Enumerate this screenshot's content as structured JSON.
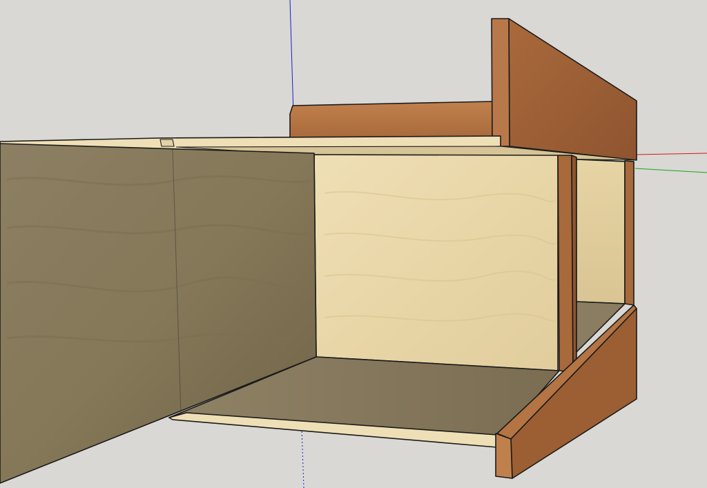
{
  "app": {
    "view": "3d-model-viewport"
  },
  "scene": {
    "background_color": "#d9d8d4",
    "axes": {
      "red_axis_color": "#d01818",
      "green_axis_color": "#1aa31a",
      "blue_axis_color": "#1a1ad6"
    },
    "materials": {
      "plywood_light": "#ead9ae",
      "plywood_shadow": "#8a7a5c",
      "plywood_floor": "#8b7d62",
      "wood_dark": "#9b5f33",
      "wood_medium": "#b07040",
      "edge_color": "#1a1a1a"
    }
  }
}
